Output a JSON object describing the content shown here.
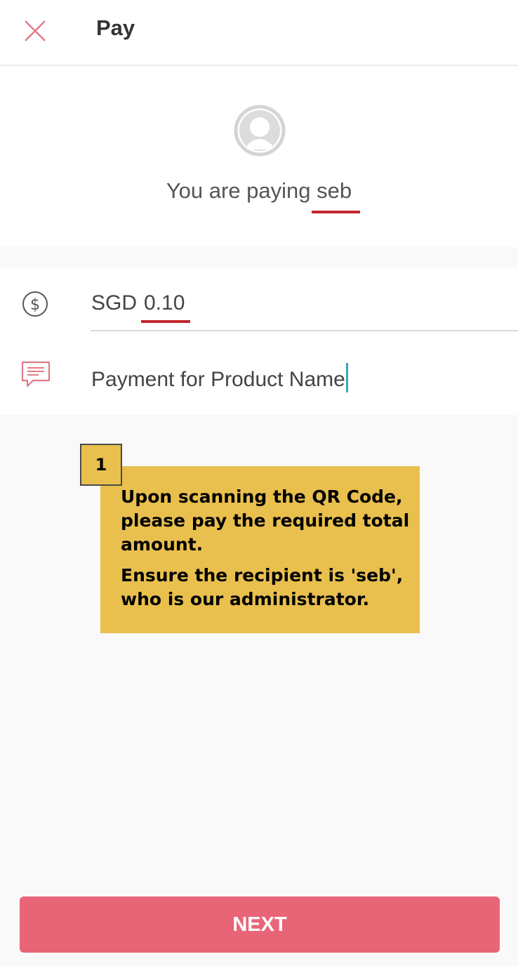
{
  "header": {
    "title": "Pay",
    "close_icon": "close-icon"
  },
  "recipient": {
    "prefix": "You are paying ",
    "name": "seb",
    "avatar_icon": "default-avatar-icon"
  },
  "form": {
    "amount_icon": "dollar-circle-icon",
    "currency": "SGD",
    "amount": "0.10",
    "message_icon": "message-icon",
    "message": "Payment for Product Name"
  },
  "annotation": {
    "number": "1",
    "paragraph_1": "Upon scanning the QR Code, please pay the required total amount.",
    "paragraph_2": "Ensure the recipient is 'seb', who is our administrator."
  },
  "footer": {
    "next_label": "NEXT"
  },
  "colors": {
    "accent_red": "#c0272d",
    "next_button": "#e86577",
    "annotation_yellow": "#e9c04e",
    "caret": "#3aa7b5"
  }
}
